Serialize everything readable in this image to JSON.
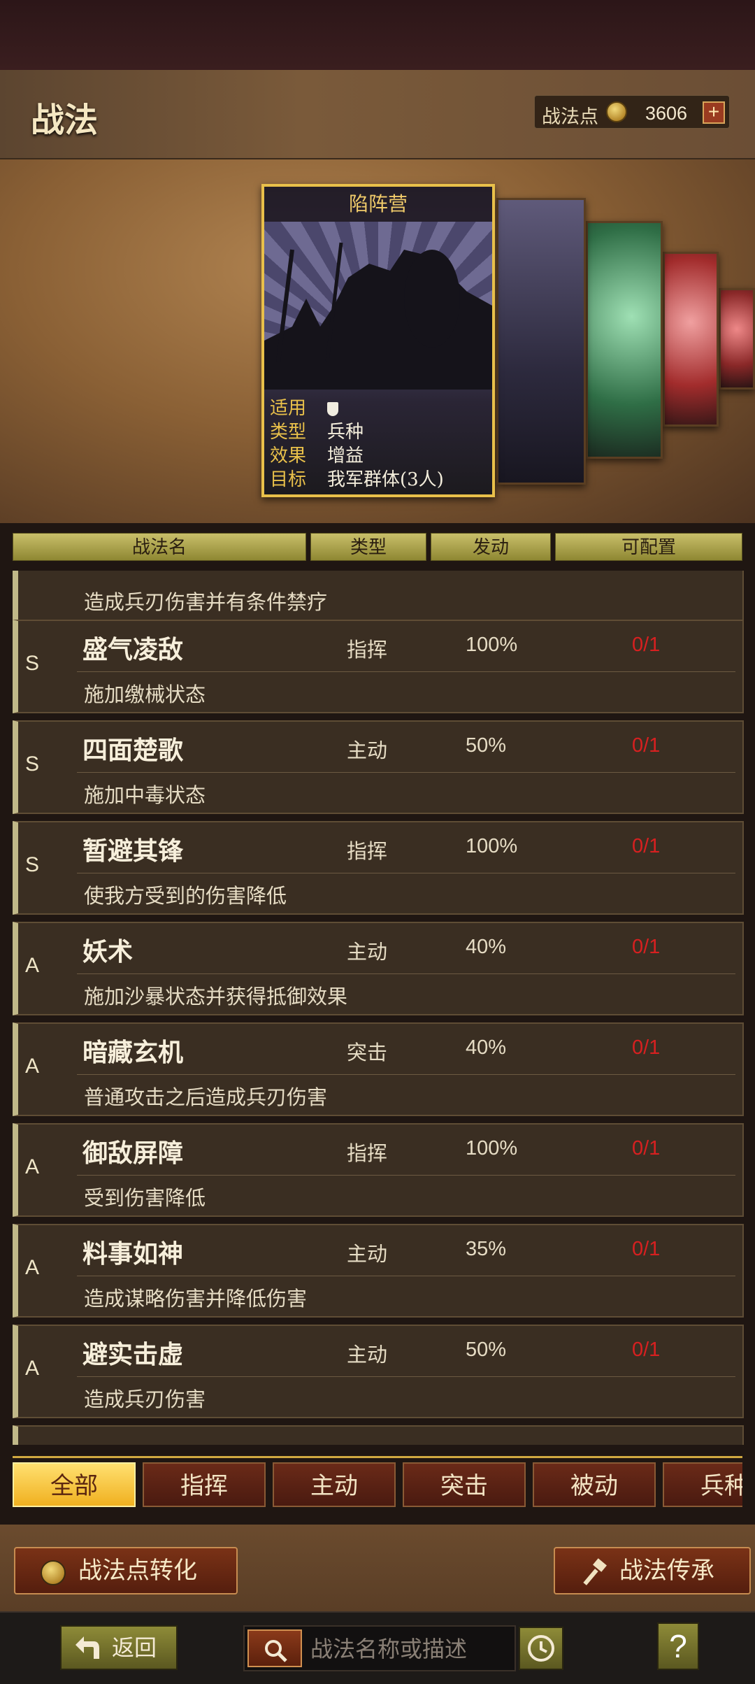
{
  "header": {
    "title": "战法",
    "points_label": "战法点",
    "points_value": "3606",
    "plus": "+"
  },
  "card": {
    "name": "陷阵营",
    "info": [
      {
        "key": "适用",
        "value": ""
      },
      {
        "key": "类型",
        "value": "兵种"
      },
      {
        "key": "效果",
        "value": "增益"
      },
      {
        "key": "目标",
        "value": "我军群体(3人)"
      }
    ]
  },
  "table": {
    "headers": [
      "战法名",
      "类型",
      "发动",
      "可配置"
    ],
    "partial_top": {
      "desc": "造成兵刃伤害并有条件禁疗"
    },
    "rows": [
      {
        "grade": "S",
        "name": "盛气凌敌",
        "type": "指挥",
        "rate": "100%",
        "config": "0/1",
        "desc": "施加缴械状态"
      },
      {
        "grade": "S",
        "name": "四面楚歌",
        "type": "主动",
        "rate": "50%",
        "config": "0/1",
        "desc": "施加中毒状态"
      },
      {
        "grade": "S",
        "name": "暂避其锋",
        "type": "指挥",
        "rate": "100%",
        "config": "0/1",
        "desc": "使我方受到的伤害降低"
      },
      {
        "grade": "A",
        "name": "妖术",
        "type": "主动",
        "rate": "40%",
        "config": "0/1",
        "desc": "施加沙暴状态并获得抵御效果"
      },
      {
        "grade": "A",
        "name": "暗藏玄机",
        "type": "突击",
        "rate": "40%",
        "config": "0/1",
        "desc": "普通攻击之后造成兵刃伤害"
      },
      {
        "grade": "A",
        "name": "御敌屏障",
        "type": "指挥",
        "rate": "100%",
        "config": "0/1",
        "desc": "受到伤害降低"
      },
      {
        "grade": "A",
        "name": "料事如神",
        "type": "主动",
        "rate": "35%",
        "config": "0/1",
        "desc": "造成谋略伤害并降低伤害"
      },
      {
        "grade": "A",
        "name": "避实击虚",
        "type": "主动",
        "rate": "50%",
        "config": "0/1",
        "desc": "造成兵刃伤害"
      }
    ]
  },
  "filters": [
    "全部",
    "指挥",
    "主动",
    "突击",
    "被动",
    "兵种"
  ],
  "actions": {
    "convert": "战法点转化",
    "inherit": "战法传承"
  },
  "footer": {
    "back": "返回",
    "search_placeholder": "战法名称或描述",
    "help": "?"
  },
  "colors": {
    "accent": "#e9c04a",
    "config_red": "#d72020",
    "active_tab": "#f0b020"
  },
  "icons": [
    "coin-icon",
    "plus-icon",
    "shield-icon",
    "hammer-icon",
    "back-arrow-icon",
    "search-icon",
    "clock-icon",
    "help-icon"
  ]
}
